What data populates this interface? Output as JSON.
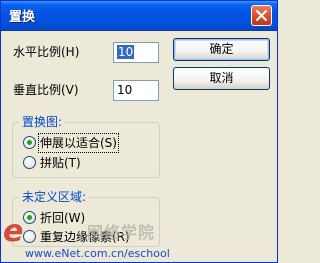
{
  "window": {
    "title": "置换"
  },
  "fields": {
    "horizontal_label": "水平比例(H)",
    "horizontal_value": "10",
    "vertical_label": "垂直比例(V)",
    "vertical_value": "10"
  },
  "buttons": {
    "ok_label": "确定",
    "cancel_label": "取消"
  },
  "displacement_map": {
    "title": "置换图:",
    "options": [
      {
        "label": "伸展以适合(S)",
        "selected": true
      },
      {
        "label": "拼贴(T)",
        "selected": false
      }
    ]
  },
  "undefined_areas": {
    "title": "未定义区域:",
    "options": [
      {
        "label": "折回(W)",
        "selected": true
      },
      {
        "label": "重复边缘像素(R)",
        "selected": false
      }
    ]
  },
  "watermark": {
    "logo_text": "e",
    "site_name": "网络学院",
    "url": "www.eNet.com.cn/eschool"
  },
  "colors": {
    "titlebar": "#0553e3",
    "dialog_bg": "#ece9d8",
    "group_title": "#0046d5",
    "selection": "#316ac5",
    "radio_dot": "#21a121",
    "watermark_red": "#d03020",
    "watermark_url": "#1d49c4"
  },
  "icons": {
    "close": "close-icon"
  }
}
